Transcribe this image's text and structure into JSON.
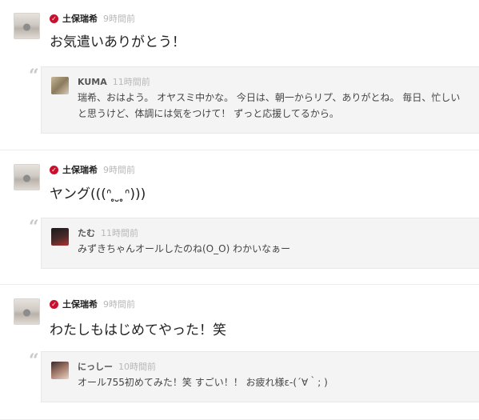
{
  "posts": [
    {
      "author": "土保瑞希",
      "time": "9時間前",
      "text": "お気遣いありがとう！",
      "reply": {
        "author": "KUMA",
        "time": "11時間前",
        "text": "瑞希、おはよう。 オヤスミ中かな。 今日は、朝一からリプ、ありがとね。 毎日、忙しいと思うけど、体調には気をつけて！ ずっと応援してるから。"
      }
    },
    {
      "author": "土保瑞希",
      "time": "9時間前",
      "text": "ヤング(((ᐢ ̥ ̮ ̥ᐢ)))",
      "reply": {
        "author": "たむ",
        "time": "11時間前",
        "text": "みずきちゃんオールしたのね(O_O) わかいなぁー"
      }
    },
    {
      "author": "土保瑞希",
      "time": "9時間前",
      "text": "わたしもはじめてやった！笑",
      "reply": {
        "author": "にっしー",
        "time": "10時間前",
        "text": "オール755初めてみた！笑 すごい！！ お疲れ様ε-(´∀｀; )"
      }
    }
  ],
  "icons": {
    "verified": "check-badge-icon",
    "quote": "quote-icon"
  },
  "colors": {
    "verified": "#c8102e",
    "reply_bg": "#f4f4f4",
    "time": "#b8b8b8"
  }
}
